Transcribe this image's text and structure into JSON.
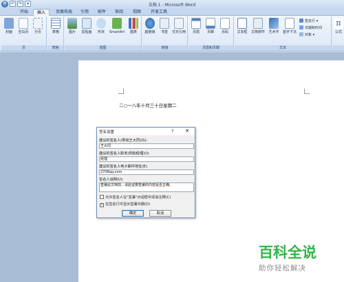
{
  "window": {
    "title": "文档 1 - Microsoft Word",
    "quick_access": [
      "W",
      "↶",
      "↷",
      "▾"
    ]
  },
  "tabs": [
    "开始",
    "插入",
    "页面布局",
    "引用",
    "邮件",
    "审阅",
    "视图",
    "开发工具"
  ],
  "ribbon": {
    "pages_group": {
      "label": "页",
      "buttons": [
        "封面",
        "空白页",
        "分页"
      ]
    },
    "table_group": {
      "label": "表格",
      "buttons": [
        "表格"
      ]
    },
    "illustrations_group": {
      "label": "插图",
      "buttons": [
        "图片",
        "剪贴画",
        "形状",
        "SmartArt",
        "图表"
      ]
    },
    "links_group": {
      "label": "链接",
      "buttons": [
        "超链接",
        "书签",
        "交叉引用"
      ]
    },
    "header_footer_group": {
      "label": "页眉和页脚",
      "buttons": [
        "页眉",
        "页脚",
        "页码"
      ]
    },
    "text_group": {
      "label": "文本",
      "buttons": [
        "文本框",
        "文档部件",
        "艺术字",
        "首字下沉"
      ],
      "small_buttons": [
        "签名行 ▾",
        "日期和时间",
        "对象 ▾"
      ]
    },
    "symbols_group": {
      "buttons": [
        "公式"
      ]
    }
  },
  "document": {
    "date_text": "二○一八年十月三十日星期二"
  },
  "dialog": {
    "title": "签名设置",
    "help": "?",
    "close": "✕",
    "signer_label": "建议的签名人(例如王大同)(S):",
    "signer_value": "王大同",
    "title_label": "建议的签名人职务(例如经理)(I):",
    "title_value": "经理",
    "email_label": "建议的签名人电子邮件地址(E):",
    "email_value": "2708qq.com",
    "instructions_label": "签名人说明(U):",
    "instructions_value": "签署此文档前，请验证要签署的内容是否正确。",
    "checkbox1_label": "允许签名人在\"签署\"对话框中添加注释(C)",
    "checkbox1_checked": "",
    "checkbox2_label": "在签名行中显示签署日期(D)",
    "checkbox2_checked": "✓",
    "ok_label": "确定",
    "cancel_label": "取消"
  },
  "watermark": {
    "main": "百科全说",
    "sub": "助你轻松解决"
  }
}
